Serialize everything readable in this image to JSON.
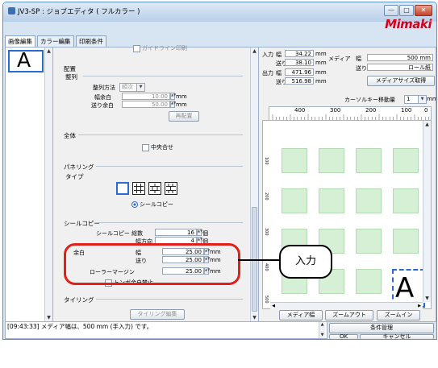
{
  "window": {
    "title": "JV3-SP : ジョブエディタ ( フルカラー )",
    "logo": "Mimaki",
    "min_label": "—",
    "max_label": "□",
    "close_label": "✕"
  },
  "tabs": [
    {
      "label": "画像編集",
      "active": true
    },
    {
      "label": "カラー編集",
      "active": false
    },
    {
      "label": "印刷条件",
      "active": false
    }
  ],
  "thumbnail": {
    "letter": "A"
  },
  "settings": {
    "top_cut_label": "ガイドライン印刷",
    "layout": {
      "title": "配置",
      "align_title": "整列",
      "align_method_label": "整列方法",
      "align_method_value": "順次",
      "width_margin_label": "幅余白",
      "width_margin_value": "10.00",
      "feed_margin_label": "送り余白",
      "feed_margin_value": "50.00",
      "unit": "mm",
      "relayout_button": "再配置"
    },
    "overall": {
      "title": "全体",
      "center_label": "中央合せ"
    },
    "paneling": {
      "title": "パネリング",
      "type_title": "タイプ",
      "seal_copy_radio": "シールコピー"
    },
    "seal_copy": {
      "title": "シールコピー",
      "total_label": "シールコピー 総数",
      "total_value": "16",
      "total_unit": "個",
      "width_dir_label": "幅方向",
      "width_dir_value": "4",
      "width_dir_unit": "個",
      "margin_label": "余白",
      "margin_width_label": "幅",
      "margin_width_value": "25.00",
      "margin_feed_label": "送り",
      "margin_feed_value": "25.00",
      "roller_margin_label": "ローラーマージン",
      "roller_margin_value": "25.00",
      "unit": "mm",
      "trim_mark_label": "トンボ余白禁止"
    },
    "tiling": {
      "title": "タイリング",
      "edit_button": "タイリング編集"
    }
  },
  "callout": {
    "label": "入力"
  },
  "info": {
    "input_label": "入力",
    "output_label": "出力",
    "width_label": "幅",
    "feed_label": "送り",
    "input_width": "34.22",
    "input_feed": "38.10",
    "output_width": "471.96",
    "output_feed": "516.98",
    "unit": "mm",
    "media_label": "メディア",
    "media_width_label": "幅",
    "media_width_value": "500 mm",
    "media_feed_label": "送り",
    "media_feed_value": "ロール紙",
    "media_size_button": "メディアサイズ取得",
    "cursor_label": "カーソルキー移動量",
    "cursor_value": "1",
    "cursor_unit": "mm"
  },
  "ruler": {
    "top_ticks": [
      "400",
      "300",
      "200",
      "100",
      "0"
    ],
    "left_ticks": [
      "100",
      "200",
      "300",
      "400",
      "500"
    ]
  },
  "preview": {
    "letter": "A",
    "columns": 4,
    "rows": 4
  },
  "preview_buttons": {
    "media_width": "メディア幅",
    "zoom_out": "ズームアウト",
    "zoom_in": "ズームイン"
  },
  "status": {
    "message": "[09:43:33] メディア幅は、500 mm (手入力) です。"
  },
  "bottom_buttons": {
    "condition": "条件管理",
    "ok": "OK",
    "cancel": "キャンセル"
  }
}
